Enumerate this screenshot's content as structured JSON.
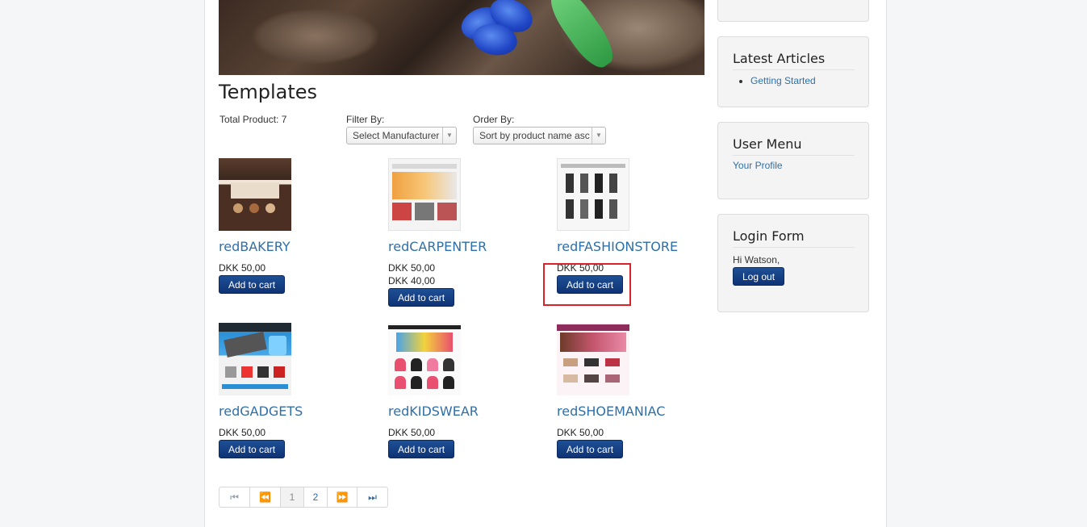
{
  "main": {
    "title": "Templates",
    "total_product": "Total Product: 7",
    "filter_label": "Filter By:",
    "filter_value": "Select Manufacturer",
    "order_label": "Order By:",
    "order_value": "Sort by product name asc"
  },
  "products": [
    {
      "name": "redBAKERY",
      "price": "DKK 50,00",
      "price2": "",
      "button": "Add to cart"
    },
    {
      "name": "redCARPENTER",
      "price": "DKK 50,00",
      "price2": "DKK 40,00",
      "button": "Add to cart"
    },
    {
      "name": "redFASHIONSTORE",
      "price": "DKK 50,00",
      "price2": "",
      "button": "Add to cart"
    },
    {
      "name": "redGADGETS",
      "price": "DKK 50,00",
      "price2": "",
      "button": "Add to cart"
    },
    {
      "name": "redKIDSWEAR",
      "price": "DKK 50,00",
      "price2": "",
      "button": "Add to cart"
    },
    {
      "name": "redSHOEMANIAC",
      "price": "DKK 50,00",
      "price2": "",
      "button": "Add to cart"
    }
  ],
  "pagination": {
    "first_icon": "first-page-icon",
    "prev_icon": "previous-page-icon",
    "next_icon": "next-page-icon",
    "last_icon": "last-page-icon",
    "pages": [
      "1",
      "2"
    ],
    "current": "1"
  },
  "sidebar": {
    "latest_articles": {
      "title": "Latest Articles",
      "items": [
        "Getting Started"
      ]
    },
    "user_menu": {
      "title": "User Menu",
      "items": [
        "Your Profile"
      ]
    },
    "login_form": {
      "title": "Login Form",
      "greeting": "Hi Watson,",
      "logout": "Log out"
    }
  },
  "colors": {
    "accent": "#2f6fa7",
    "button": "#0e3375",
    "highlight": "#d9222a"
  }
}
